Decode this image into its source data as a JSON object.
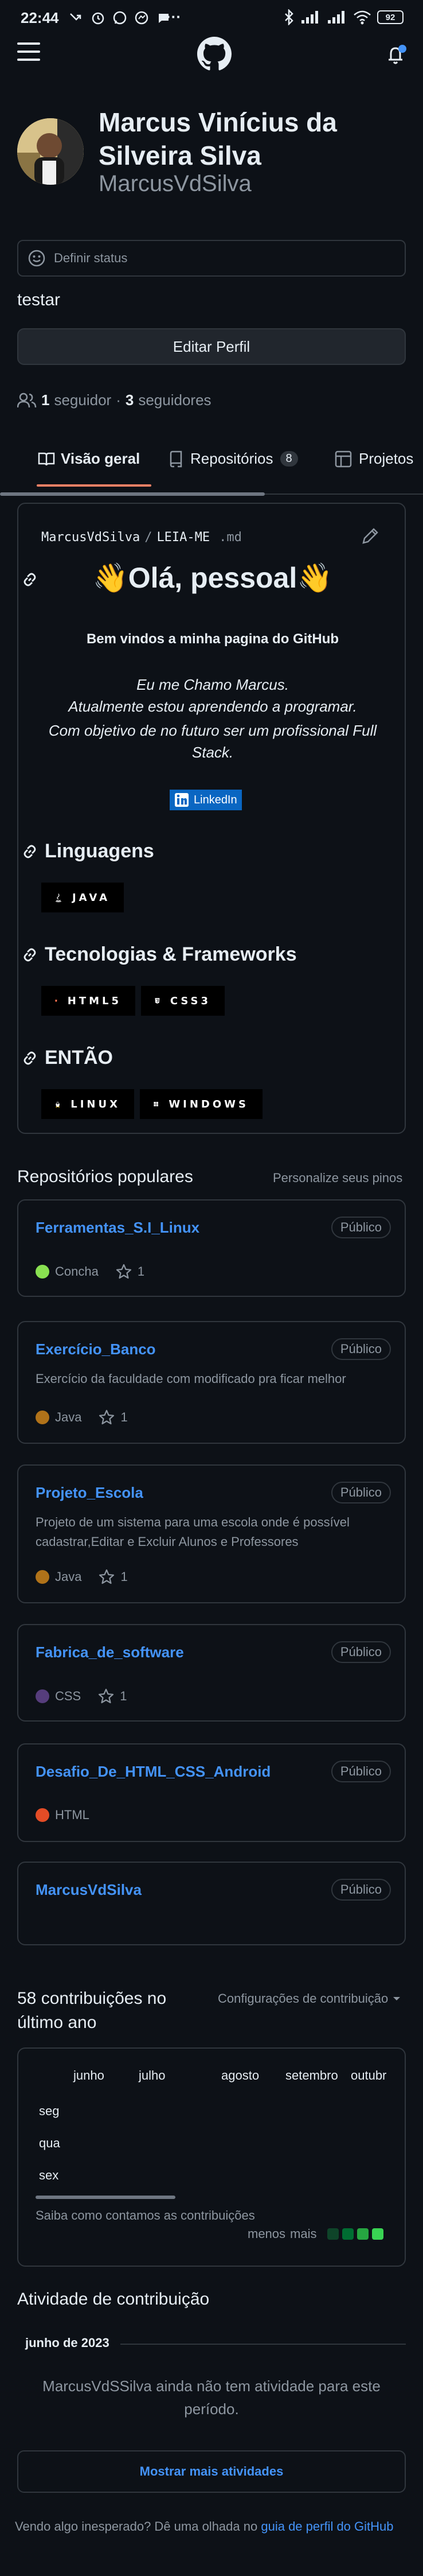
{
  "status_bar": {
    "time": "22:44",
    "more": "···",
    "battery": "92"
  },
  "profile": {
    "name": "Marcus Vinícius da Silveira Silva",
    "username": "MarcusVdSilva",
    "status_placeholder": "Definir status",
    "bio": "testar",
    "edit_button": "Editar Perfil",
    "followers_count": "1",
    "followers_label": "seguidor",
    "separator": "·",
    "following_count": "3",
    "following_label": "seguidores"
  },
  "tabs": {
    "overview": "Visão geral",
    "repositories": "Repositórios",
    "repositories_count": "8",
    "projects": "Projetos"
  },
  "readme": {
    "owner": "MarcusVdSilva",
    "slash": "/",
    "file": "LEIA-ME",
    "ext": ".md",
    "greeting": "👋Olá, pessoal👋",
    "welcome": "Bem vindos a minha pagina do GitHub",
    "intro_line1": "Eu me Chamo Marcus.",
    "intro_line2": "Atualmente estou aprendendo a programar.",
    "intro_line3": "Com objetivo de no futuro ser um profissional Full Stack.",
    "linkedin": "LinkedIn",
    "section_languages": "Linguagens",
    "badge_java": "JAVA",
    "section_tech": "Tecnologias & Frameworks",
    "badge_html5": "HTML5",
    "badge_css3": "CSS3",
    "section_then": "ENTÃO",
    "badge_linux": "LINUX",
    "badge_windows": "WINDOWS"
  },
  "popular": {
    "title": "Repositórios populares",
    "customize": "Personalize seus pinos",
    "visibility": "Público",
    "repos": [
      {
        "name": "Ferramentas_S.I_Linux",
        "description": "",
        "language": "Concha",
        "color": "#89e051",
        "stars": "1"
      },
      {
        "name": "Exercício_Banco",
        "description": "Exercício da faculdade com modificado pra ficar melhor",
        "language": "Java",
        "color": "#b07219",
        "stars": "1"
      },
      {
        "name": "Projeto_Escola",
        "description": "Projeto de um sistema para uma escola onde é possível cadastrar,Editar e Excluir Alunos e Professores",
        "language": "Java",
        "color": "#b07219",
        "stars": "1"
      },
      {
        "name": "Fabrica_de_software",
        "description": "",
        "language": "CSS",
        "color": "#563d7c",
        "stars": "1"
      },
      {
        "name": "Desafio_De_HTML_CSS_Android",
        "description": "",
        "language": "HTML",
        "color": "#e34c26",
        "stars": ""
      },
      {
        "name": "MarcusVdSilva",
        "description": "",
        "language": "",
        "color": "",
        "stars": ""
      }
    ]
  },
  "contributions": {
    "count_title": "58 contribuições no último ano",
    "settings": "Configurações de contribuição",
    "months": [
      "junho",
      "julho",
      "agosto",
      "setembro",
      "outubr"
    ],
    "days": [
      "seg",
      "qua",
      "sex"
    ],
    "how_we_count": "Saiba como contamos as contribuições",
    "less": "menos",
    "more": "mais"
  },
  "activity": {
    "title": "Atividade de contribuição",
    "month": "junho de 2023",
    "empty": "MarcusVdSSilva ainda não tem atividade para este período.",
    "show_more": "Mostrar mais atividades"
  },
  "footer": {
    "text": "Vendo algo inesperado? Dê uma olhada no",
    "link": "guia de perfil do GitHub"
  },
  "colors": {
    "accent": "#4493f8",
    "tab_underline": "#f78166",
    "background": "#0d1117",
    "border": "#30363d"
  }
}
